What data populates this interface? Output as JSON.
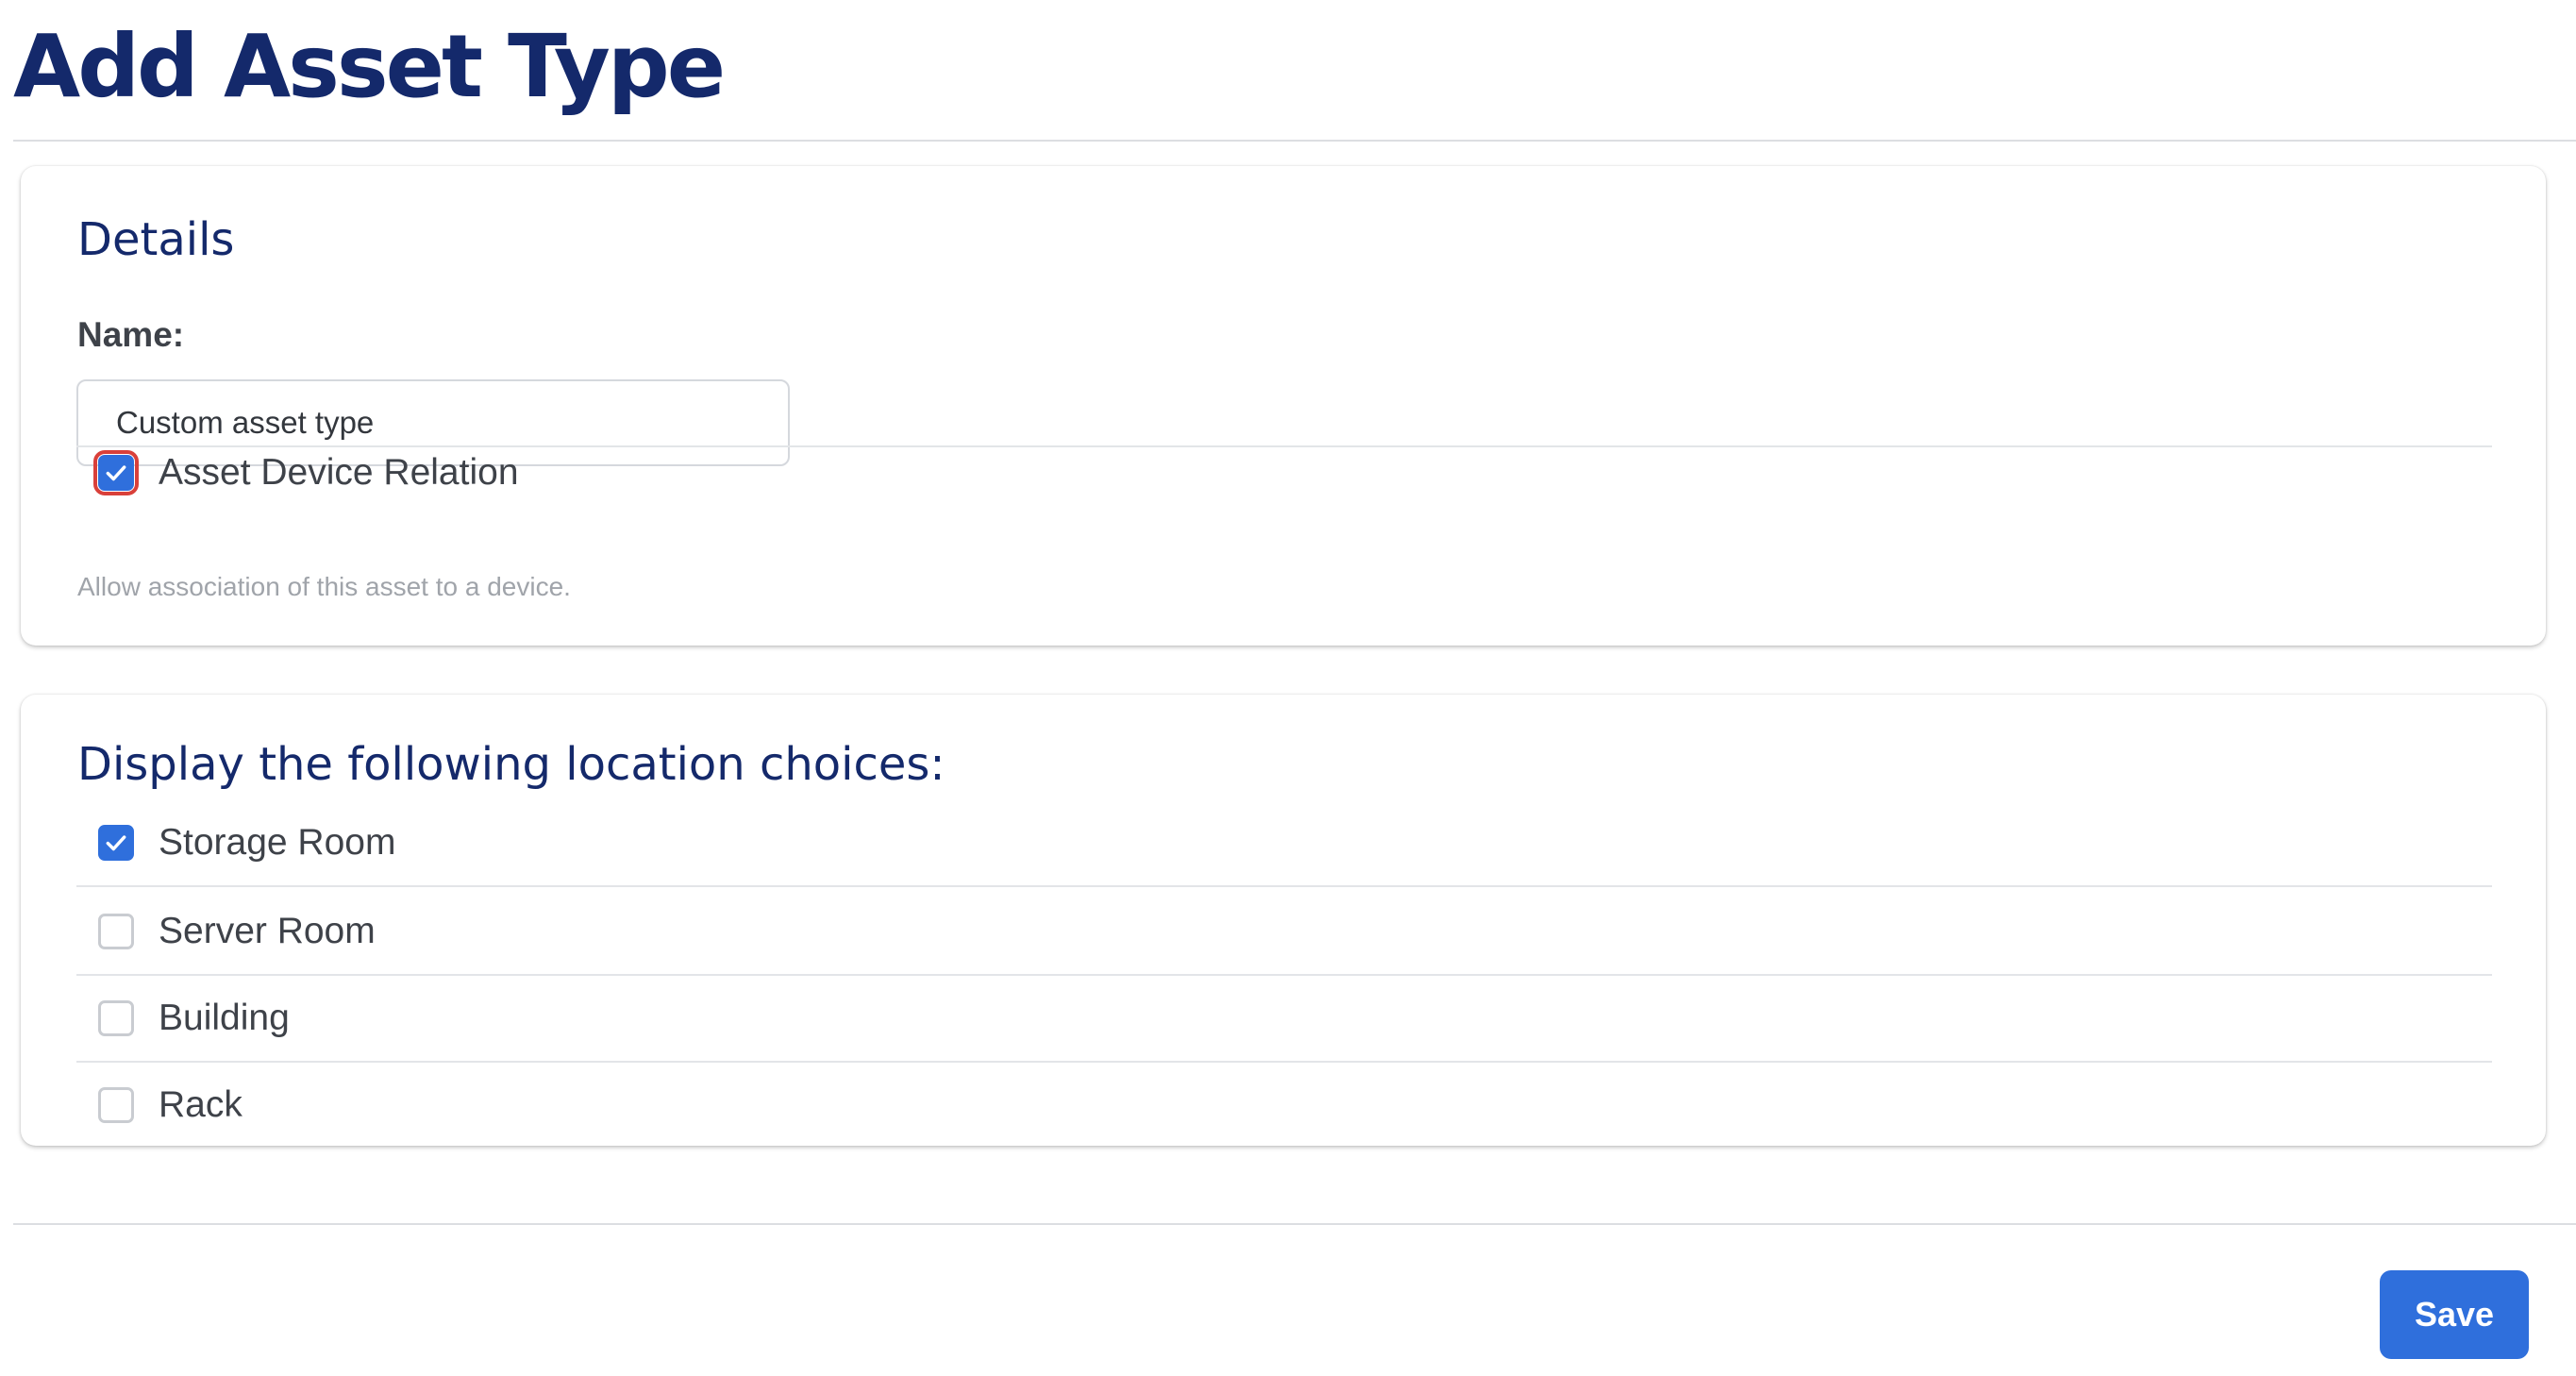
{
  "page": {
    "title": "Add Asset Type"
  },
  "details": {
    "heading": "Details",
    "name_label": "Name:",
    "name_value": "Custom asset type",
    "relation": {
      "label": "Asset Device Relation",
      "checked": true,
      "help": "Allow association of this asset to a device."
    }
  },
  "locations": {
    "heading": "Display the following location choices:",
    "items": [
      {
        "label": "Storage Room",
        "checked": true
      },
      {
        "label": "Server Room",
        "checked": false
      },
      {
        "label": "Building",
        "checked": false
      },
      {
        "label": "Rack",
        "checked": false
      }
    ]
  },
  "actions": {
    "save_label": "Save"
  },
  "colors": {
    "title": "#14296b",
    "accent": "#2f6fdc",
    "focus_outline": "#d9403a"
  },
  "icons": {
    "checkmark": "checkmark-icon"
  }
}
